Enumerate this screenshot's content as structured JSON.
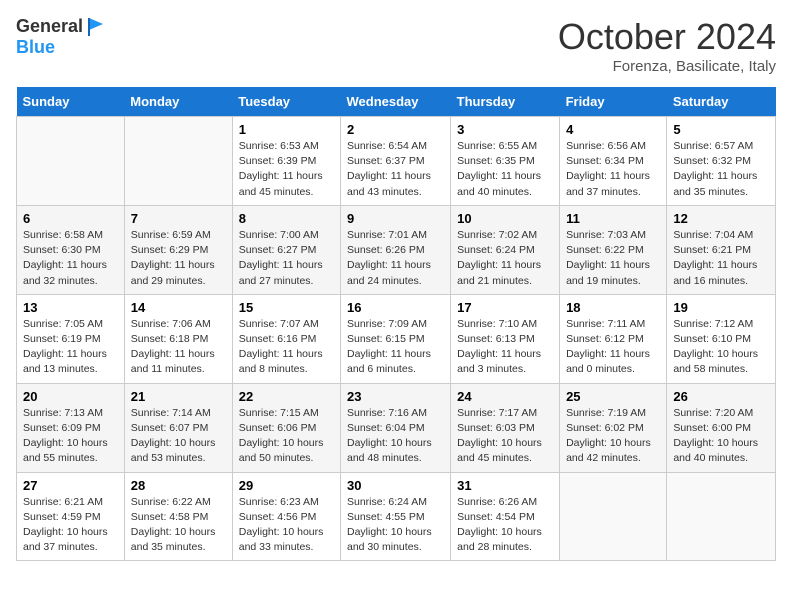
{
  "header": {
    "logo_general": "General",
    "logo_blue": "Blue",
    "month_title": "October 2024",
    "location": "Forenza, Basilicate, Italy"
  },
  "weekdays": [
    "Sunday",
    "Monday",
    "Tuesday",
    "Wednesday",
    "Thursday",
    "Friday",
    "Saturday"
  ],
  "weeks": [
    [
      {
        "day": "",
        "info": ""
      },
      {
        "day": "",
        "info": ""
      },
      {
        "day": "1",
        "info": "Sunrise: 6:53 AM\nSunset: 6:39 PM\nDaylight: 11 hours and 45 minutes."
      },
      {
        "day": "2",
        "info": "Sunrise: 6:54 AM\nSunset: 6:37 PM\nDaylight: 11 hours and 43 minutes."
      },
      {
        "day": "3",
        "info": "Sunrise: 6:55 AM\nSunset: 6:35 PM\nDaylight: 11 hours and 40 minutes."
      },
      {
        "day": "4",
        "info": "Sunrise: 6:56 AM\nSunset: 6:34 PM\nDaylight: 11 hours and 37 minutes."
      },
      {
        "day": "5",
        "info": "Sunrise: 6:57 AM\nSunset: 6:32 PM\nDaylight: 11 hours and 35 minutes."
      }
    ],
    [
      {
        "day": "6",
        "info": "Sunrise: 6:58 AM\nSunset: 6:30 PM\nDaylight: 11 hours and 32 minutes."
      },
      {
        "day": "7",
        "info": "Sunrise: 6:59 AM\nSunset: 6:29 PM\nDaylight: 11 hours and 29 minutes."
      },
      {
        "day": "8",
        "info": "Sunrise: 7:00 AM\nSunset: 6:27 PM\nDaylight: 11 hours and 27 minutes."
      },
      {
        "day": "9",
        "info": "Sunrise: 7:01 AM\nSunset: 6:26 PM\nDaylight: 11 hours and 24 minutes."
      },
      {
        "day": "10",
        "info": "Sunrise: 7:02 AM\nSunset: 6:24 PM\nDaylight: 11 hours and 21 minutes."
      },
      {
        "day": "11",
        "info": "Sunrise: 7:03 AM\nSunset: 6:22 PM\nDaylight: 11 hours and 19 minutes."
      },
      {
        "day": "12",
        "info": "Sunrise: 7:04 AM\nSunset: 6:21 PM\nDaylight: 11 hours and 16 minutes."
      }
    ],
    [
      {
        "day": "13",
        "info": "Sunrise: 7:05 AM\nSunset: 6:19 PM\nDaylight: 11 hours and 13 minutes."
      },
      {
        "day": "14",
        "info": "Sunrise: 7:06 AM\nSunset: 6:18 PM\nDaylight: 11 hours and 11 minutes."
      },
      {
        "day": "15",
        "info": "Sunrise: 7:07 AM\nSunset: 6:16 PM\nDaylight: 11 hours and 8 minutes."
      },
      {
        "day": "16",
        "info": "Sunrise: 7:09 AM\nSunset: 6:15 PM\nDaylight: 11 hours and 6 minutes."
      },
      {
        "day": "17",
        "info": "Sunrise: 7:10 AM\nSunset: 6:13 PM\nDaylight: 11 hours and 3 minutes."
      },
      {
        "day": "18",
        "info": "Sunrise: 7:11 AM\nSunset: 6:12 PM\nDaylight: 11 hours and 0 minutes."
      },
      {
        "day": "19",
        "info": "Sunrise: 7:12 AM\nSunset: 6:10 PM\nDaylight: 10 hours and 58 minutes."
      }
    ],
    [
      {
        "day": "20",
        "info": "Sunrise: 7:13 AM\nSunset: 6:09 PM\nDaylight: 10 hours and 55 minutes."
      },
      {
        "day": "21",
        "info": "Sunrise: 7:14 AM\nSunset: 6:07 PM\nDaylight: 10 hours and 53 minutes."
      },
      {
        "day": "22",
        "info": "Sunrise: 7:15 AM\nSunset: 6:06 PM\nDaylight: 10 hours and 50 minutes."
      },
      {
        "day": "23",
        "info": "Sunrise: 7:16 AM\nSunset: 6:04 PM\nDaylight: 10 hours and 48 minutes."
      },
      {
        "day": "24",
        "info": "Sunrise: 7:17 AM\nSunset: 6:03 PM\nDaylight: 10 hours and 45 minutes."
      },
      {
        "day": "25",
        "info": "Sunrise: 7:19 AM\nSunset: 6:02 PM\nDaylight: 10 hours and 42 minutes."
      },
      {
        "day": "26",
        "info": "Sunrise: 7:20 AM\nSunset: 6:00 PM\nDaylight: 10 hours and 40 minutes."
      }
    ],
    [
      {
        "day": "27",
        "info": "Sunrise: 6:21 AM\nSunset: 4:59 PM\nDaylight: 10 hours and 37 minutes."
      },
      {
        "day": "28",
        "info": "Sunrise: 6:22 AM\nSunset: 4:58 PM\nDaylight: 10 hours and 35 minutes."
      },
      {
        "day": "29",
        "info": "Sunrise: 6:23 AM\nSunset: 4:56 PM\nDaylight: 10 hours and 33 minutes."
      },
      {
        "day": "30",
        "info": "Sunrise: 6:24 AM\nSunset: 4:55 PM\nDaylight: 10 hours and 30 minutes."
      },
      {
        "day": "31",
        "info": "Sunrise: 6:26 AM\nSunset: 4:54 PM\nDaylight: 10 hours and 28 minutes."
      },
      {
        "day": "",
        "info": ""
      },
      {
        "day": "",
        "info": ""
      }
    ]
  ]
}
